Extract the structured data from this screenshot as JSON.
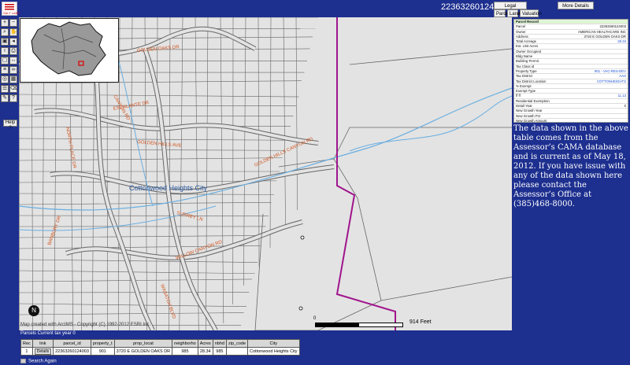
{
  "header": {
    "parcel_id": "22363260124003",
    "legal_description_btn": "Legal Description",
    "more_details_btn": "More Details",
    "parcel_btn": "Parcel",
    "land_btn": "Land",
    "valuation_btn": "Valuation"
  },
  "logo": {
    "text": "SALT LAKE"
  },
  "toolbar": {
    "help_label": "Help ?",
    "tools": [
      {
        "icon": "zoom-in-icon",
        "glyph": "+"
      },
      {
        "icon": "zoom-out-icon",
        "glyph": "−"
      },
      {
        "icon": "magnify-icon",
        "glyph": "⌕"
      },
      {
        "icon": "pan-icon",
        "glyph": "✋"
      },
      {
        "icon": "full-extent-icon",
        "glyph": "▣"
      },
      {
        "icon": "previous-extent-icon",
        "glyph": "◂"
      },
      {
        "icon": "identify-icon",
        "glyph": "i"
      },
      {
        "icon": "print-icon",
        "glyph": "⎙"
      },
      {
        "icon": "select-icon",
        "glyph": "▢"
      },
      {
        "icon": "measure-icon",
        "glyph": "↔"
      },
      {
        "icon": "layers-icon",
        "glyph": "≡"
      },
      {
        "icon": "binoculars-icon",
        "glyph": "∞"
      },
      {
        "icon": "buffer-icon",
        "glyph": "◎"
      },
      {
        "icon": "table-icon",
        "glyph": "▦"
      },
      {
        "icon": "legend-icon",
        "glyph": "☰"
      },
      {
        "icon": "clear-icon",
        "glyph": "⌫"
      },
      {
        "icon": "draw-icon",
        "glyph": "✎"
      },
      {
        "icon": "help-icon",
        "glyph": "?"
      }
    ]
  },
  "map": {
    "city_label": "Cottonwood Heights City",
    "copyright": "Map created with ArcIMS - Copyright (C) 1992-2012 ESRI Inc.",
    "scale_zero": "0",
    "scale_label": "914 Feet",
    "north_glyph": "N",
    "colors": {
      "background": "#e3e3e3",
      "parcel": "#666666",
      "stream": "#6aaee0",
      "boundary": "#a0148c",
      "road_label": "#d2541e",
      "city_label": "#2c5a9e"
    },
    "street_labels": [
      "GOLDEN OAKS DR",
      "CANYON RD",
      "ESCALANTE DR",
      "GOLDEN HILLS AVE",
      "GOLDEN HILLS CANYON RD",
      "SURREY LN",
      "WILLOW CANYON RD",
      "WASATCH BLVD",
      "NORTH PLACE DR",
      "BANBURY DR"
    ]
  },
  "parcel_record": [
    {
      "key": "Parcel Record",
      "value": "",
      "head": true
    },
    {
      "key": "Parcel",
      "value": "22363260124003"
    },
    {
      "key": "Owner",
      "value": "AMERICAN HEALTHCARE INC"
    },
    {
      "key": "Address",
      "value": "3720 E GOLDEN OAKS DR"
    },
    {
      "key": "Total Acreage",
      "value": "28.34",
      "link": true
    },
    {
      "key": "Est. Unit Acres",
      "value": ""
    },
    {
      "key": "Owner Occupied",
      "value": ""
    },
    {
      "key": "Bldg Name",
      "value": ""
    },
    {
      "key": "Building Permit",
      "value": ""
    },
    {
      "key": "Tax Class id",
      "value": ""
    },
    {
      "key": "Property Type",
      "value": "901 - VAC-RES-DEV",
      "link": true
    },
    {
      "key": "Tax District",
      "value": "AAH",
      "link": true
    },
    {
      "key": "Tax District Location",
      "value": "COTTONHEIGHTS",
      "link": true
    },
    {
      "key": "% Exempt",
      "value": ""
    },
    {
      "key": "Exempt Type",
      "value": ""
    },
    {
      "key": "ff ff",
      "value": "11.13",
      "link": true
    },
    {
      "key": "Residential Exemption",
      "value": ""
    },
    {
      "key": "Detail Year",
      "value": "0"
    },
    {
      "key": "New Growth Year",
      "value": ""
    },
    {
      "key": "New Growth Pct",
      "value": ""
    },
    {
      "key": "New Growth Amount",
      "value": ""
    },
    {
      "key": "Update Year",
      "value": ""
    },
    {
      "key": "Reinspection",
      "value": ""
    },
    {
      "key": "Total Associated",
      "value": ""
    },
    {
      "key": "MLS Number",
      "value": ""
    }
  ],
  "disclaimer": "The data shown in the above table comes from the Assessor’s CAMA database and is current as of May 18, 2012. If you have issue with any of the data shown here please contact the Assessor’s Office at (385)468-8000.",
  "results": {
    "title": "Parcels Current tax year 0",
    "columns": [
      "Rec",
      "link",
      "parcel_id",
      "property_t",
      "prop_locat",
      "neighborho",
      "Acres",
      "nbhd",
      "zip_code",
      "City"
    ],
    "rows": [
      [
        "1",
        "Details",
        "22363260124003",
        "901",
        "3720 E GOLDEN OAKS DR",
        "985",
        "28.34",
        "985",
        "",
        "Cottonwood Heights City"
      ]
    ],
    "search_again": "Search Again"
  }
}
